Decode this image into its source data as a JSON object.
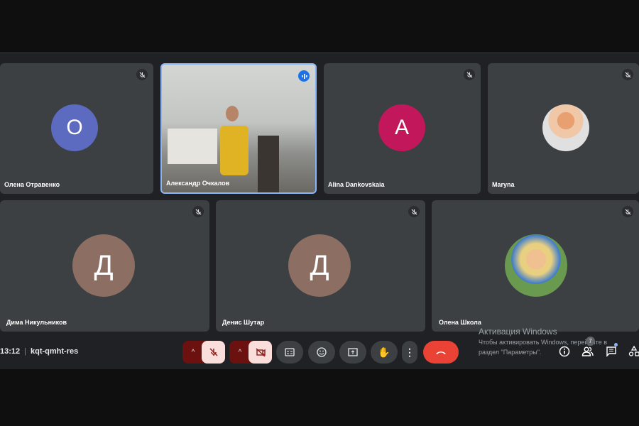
{
  "participants": [
    {
      "name": "Олена Отравенко",
      "initial": "O",
      "color": "#5c6bc0",
      "muted": true
    },
    {
      "name": "Александр Очкалов",
      "video": true,
      "speaking": true
    },
    {
      "name": "Alina Dankovskaia",
      "initial": "A",
      "color": "#c2185b",
      "muted": true
    },
    {
      "name": "Maryna",
      "photo": true,
      "muted": true
    },
    {
      "name": "Дима Никульников",
      "initial": "Д",
      "color": "#8d6e63",
      "muted": true
    },
    {
      "name": "Денис Шутар",
      "initial": "Д",
      "color": "#8d6e63",
      "muted": true
    },
    {
      "name": "Олена Школа",
      "photo": true,
      "muted": true
    }
  ],
  "bar": {
    "time": "13:12",
    "separator": "|",
    "code": "kqt-qmht-res",
    "people_count": "7"
  },
  "watermark": {
    "title": "Активация Windows",
    "line1": "Чтобы активировать Windows, перейдите в",
    "line2": "раздел \"Параметры\"."
  },
  "colors": {
    "accent": "#8ab4f8",
    "end_call": "#ea4335"
  }
}
